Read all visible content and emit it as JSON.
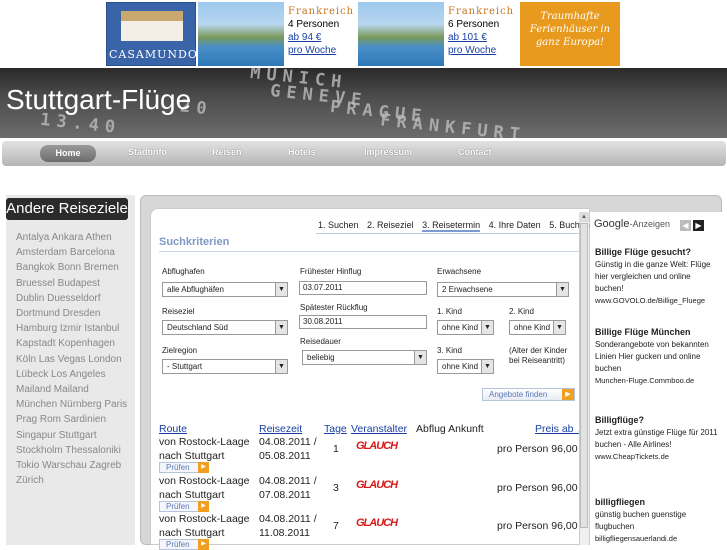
{
  "banner": {
    "brand": "CASAMUNDO",
    "offers": [
      {
        "country": "Frankreich",
        "persons": "4 Personen",
        "price": "ab 94 €",
        "period": "pro Woche"
      },
      {
        "country": "Frankreich",
        "persons": "6 Personen",
        "price": "ab 101 €",
        "period": "pro Woche"
      }
    ],
    "slogan": "Traumhafte Ferienhäuser in ganz Europa!"
  },
  "header": {
    "title": "Stuttgart-Flüge",
    "board": [
      "MUNICH",
      "GENEVE",
      "PRAGUE",
      "FRANKFURT",
      "13.40",
      "20"
    ]
  },
  "nav": {
    "items": [
      "Home",
      "Stadtinfo",
      "Reisen",
      "Hotels",
      "Impressum",
      "Contact"
    ]
  },
  "sidebar": {
    "title": "Andere Reiseziele",
    "links": "Antalya Ankara Athen Amsterdam Barcelona Bangkok Bonn Bremen Bruessel Budapest Dublin Duesseldorf Dortmund Dresden Hamburg Izmir Istanbul Kapstadt Kopenhagen Köln Las Vegas London Lübeck Los Angeles Mailand Mailand München Nürnberg Paris Prag Rom Sardinien Singapur Stuttgart Stockholm Thessaloniki Tokio Warschau Zagreb Zürich"
  },
  "steps": [
    "1. Suchen",
    "2. Reiseziel",
    "3. Reisetermin",
    "4. Ihre Daten",
    "5. Buchung"
  ],
  "search": {
    "heading": "Suchkriterien",
    "abflughafen_label": "Abflughafen",
    "abflughafen_value": "alle Abflughäfen",
    "fruehester_label": "Frühester Hinflug",
    "fruehester_value": "03.07.2011",
    "erwachsene_label": "Erwachsene",
    "erwachsene_value": "2 Erwachsene",
    "reiseziel_label": "Reiseziel",
    "reiseziel_value": "Deutschland Süd",
    "spaetester_label": "Spätester Rückflug",
    "spaetester_value": "30.08.2011",
    "kind1_label": "1. Kind",
    "kind1_value": "ohne Kind",
    "kind2_label": "2. Kind",
    "kind2_value": "ohne Kind",
    "zielregion_label": "Zielregion",
    "zielregion_value": "- Stuttgart",
    "reisedauer_label": "Reisedauer",
    "reisedauer_value": "beliebig",
    "kind3_label": "3. Kind",
    "kind3_value": "ohne Kind",
    "kinder_note": "(Alter der Kinder bei Reiseantritt)",
    "button": "Angebote finden"
  },
  "results": {
    "headers": [
      "Route",
      "Reisezeit",
      "Tage",
      "Veranstalter",
      "Abflug Ankunft",
      "Preis ab ▲"
    ],
    "check_label": "Prüfen",
    "rows": [
      {
        "route": "von Rostock-Laage nach Stuttgart",
        "dates": "04.08.2011 / 05.08.2011",
        "days": "1",
        "operator": "GLAUCH",
        "price": "pro Person 96,00 €"
      },
      {
        "route": "von Rostock-Laage nach Stuttgart",
        "dates": "04.08.2011 / 07.08.2011",
        "days": "3",
        "operator": "GLAUCH",
        "price": "pro Person 96,00 €"
      },
      {
        "route": "von Rostock-Laage nach Stuttgart",
        "dates": "04.08.2011 / 11.08.2011",
        "days": "7",
        "operator": "GLAUCH",
        "price": "pro Person 96,00 €"
      }
    ]
  },
  "ads": {
    "google": "Google",
    "label": "-Anzeigen",
    "items": [
      {
        "title": "Billige Flüge gesucht?",
        "text": "Günstig in die ganze Welt: Flüge hier vergleichen und online buchen!",
        "url": "www.GOVOLO.de/Billige_Fluege"
      },
      {
        "title": "Billige Flüge München",
        "text": "Sonderangebote von bekannten Linien Hier gucken und online buchen",
        "url": "Munchen-Fluge.Commboo.de"
      },
      {
        "title": "Billigflüge?",
        "text": "Jetzt extra günstige Flüge für 2011 buchen - Alle Airlines!",
        "url": "www.CheapTickets.de"
      },
      {
        "title": "billigfliegen",
        "text": "günstig buchen guenstige flugbuchen",
        "url": "billigfliegensauerlandi.de"
      }
    ]
  }
}
